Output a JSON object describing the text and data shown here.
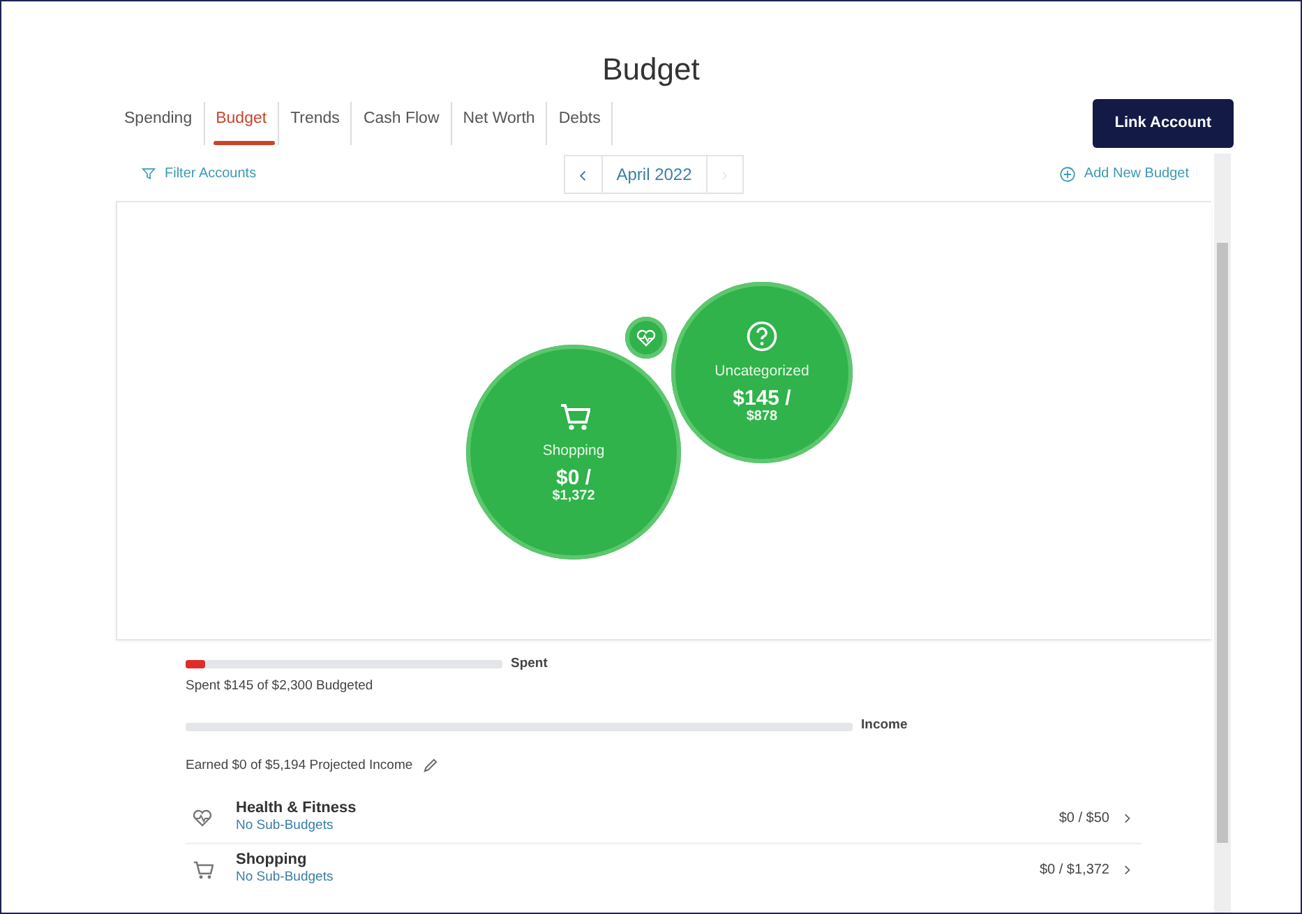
{
  "title": "Budget",
  "tabs": [
    {
      "label": "Spending",
      "selected": false
    },
    {
      "label": "Budget",
      "selected": true
    },
    {
      "label": "Trends",
      "selected": false
    },
    {
      "label": "Cash Flow",
      "selected": false
    },
    {
      "label": "Net Worth",
      "selected": false
    },
    {
      "label": "Debts",
      "selected": false
    }
  ],
  "link_button": "Link Account",
  "filter": "Filter Accounts",
  "month": {
    "label": "April 2022",
    "next_disabled": true
  },
  "add_budget": "Add New Budget",
  "bubbles": [
    {
      "kind": "heart"
    },
    {
      "kind": "cart",
      "label": "Shopping",
      "spent": "$0 /",
      "budget": "$1,372"
    },
    {
      "kind": "question",
      "label": "Uncategorized",
      "spent": "$145 /",
      "budget": "$878"
    }
  ],
  "spent_bar": {
    "label": "Spent",
    "level": 0.06,
    "caption": "Spent $145 of $2,300 Budgeted"
  },
  "income_bar": {
    "label": "Income",
    "caption": "Earned $0 of $5,194 Projected Income"
  },
  "categories": [
    {
      "kind": "heart",
      "name": "Health & Fitness",
      "sub": "No Sub-Budgets",
      "amount": "$0 / $50"
    },
    {
      "kind": "cart",
      "name": "Shopping",
      "sub": "No Sub-Budgets",
      "amount": "$0 / $1,372"
    }
  ]
}
